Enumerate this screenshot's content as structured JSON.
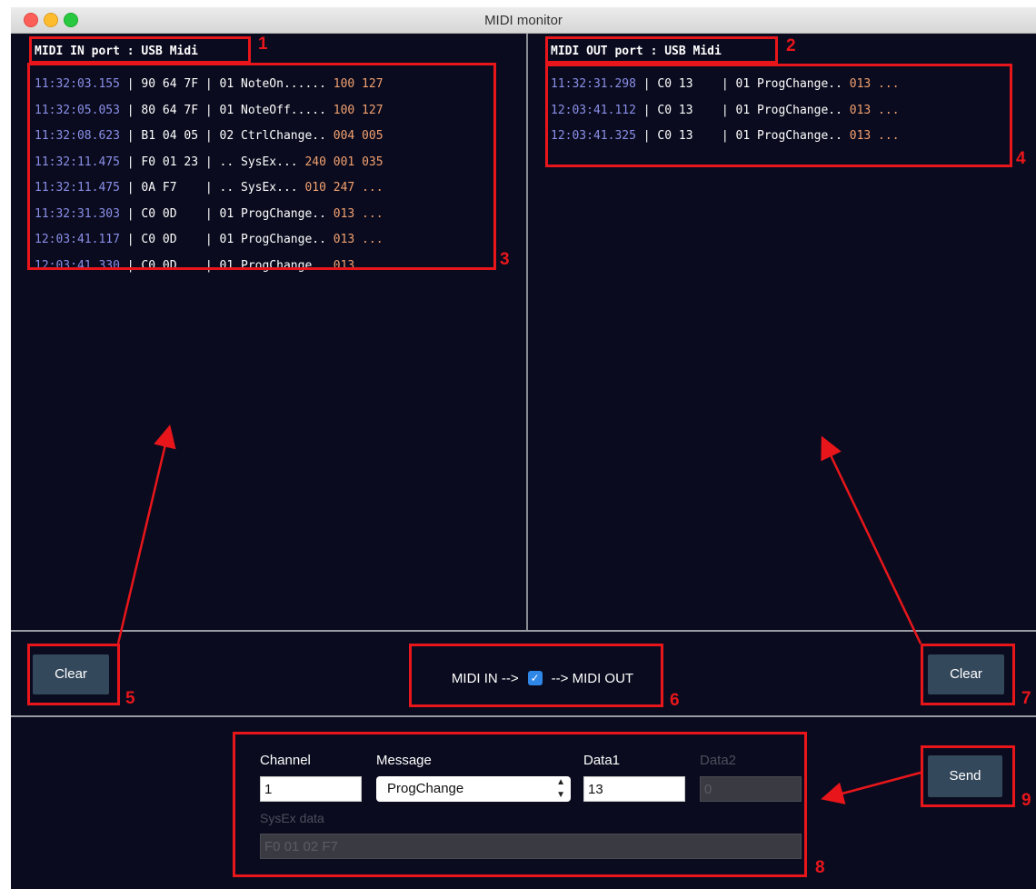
{
  "window": {
    "title": "MIDI monitor"
  },
  "midi_in": {
    "port_label": "MIDI IN port : USB Midi",
    "rows": [
      {
        "time": "11:32:03.155",
        "bytes": "90 64 7F",
        "ch": "01",
        "msg": "NoteOn......",
        "vals": "100 127"
      },
      {
        "time": "11:32:05.053",
        "bytes": "80 64 7F",
        "ch": "01",
        "msg": "NoteOff.....",
        "vals": "100 127"
      },
      {
        "time": "11:32:08.623",
        "bytes": "B1 04 05",
        "ch": "02",
        "msg": "CtrlChange..",
        "vals": "004 005"
      },
      {
        "time": "11:32:11.475",
        "bytes": "F0 01 23",
        "ch": "..",
        "msg": "SysEx...",
        "vals": "240 001 035"
      },
      {
        "time": "11:32:11.475",
        "bytes": "0A F7   ",
        "ch": "..",
        "msg": "SysEx...",
        "vals": "010 247 ..."
      },
      {
        "time": "11:32:31.303",
        "bytes": "C0 0D   ",
        "ch": "01",
        "msg": "ProgChange..",
        "vals": "013 ..."
      },
      {
        "time": "12:03:41.117",
        "bytes": "C0 0D   ",
        "ch": "01",
        "msg": "ProgChange..",
        "vals": "013 ..."
      },
      {
        "time": "12:03:41.330",
        "bytes": "C0 0D   ",
        "ch": "01",
        "msg": "ProgChange..",
        "vals": "013 ..."
      }
    ],
    "clear_label": "Clear"
  },
  "midi_out": {
    "port_label": "MIDI OUT port : USB Midi",
    "rows": [
      {
        "time": "11:32:31.298",
        "bytes": "C0 13   ",
        "ch": "01",
        "msg": "ProgChange..",
        "vals": "013 ..."
      },
      {
        "time": "12:03:41.112",
        "bytes": "C0 13   ",
        "ch": "01",
        "msg": "ProgChange..",
        "vals": "013 ..."
      },
      {
        "time": "12:03:41.325",
        "bytes": "C0 13   ",
        "ch": "01",
        "msg": "ProgChange..",
        "vals": "013 ..."
      }
    ],
    "clear_label": "Clear"
  },
  "thru": {
    "left_label": "MIDI IN -->",
    "right_label": "--> MIDI OUT",
    "checked": true,
    "check_glyph": "✓"
  },
  "send_form": {
    "channel_label": "Channel",
    "channel_value": "1",
    "message_label": "Message",
    "message_value": "ProgChange",
    "data1_label": "Data1",
    "data1_value": "13",
    "data2_label": "Data2",
    "data2_value": "0",
    "sysex_label": "SysEx data",
    "sysex_value": "F0 01 02 F7",
    "send_label": "Send"
  },
  "annotations": [
    "1",
    "2",
    "3",
    "4",
    "5",
    "6",
    "7",
    "8",
    "9"
  ],
  "colors": {
    "background": "#0a0b1e",
    "timestamp": "#8a8fe8",
    "value": "#f2a170",
    "annotation": "#e8161b",
    "button": "#34485c"
  }
}
